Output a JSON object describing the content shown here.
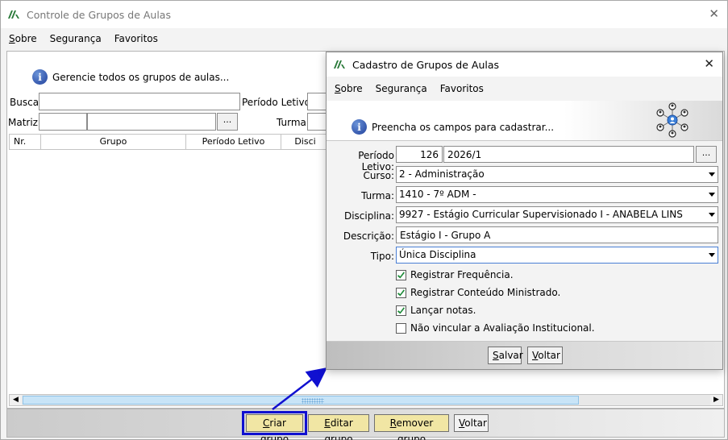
{
  "main": {
    "title": "Controle de Grupos de Aulas",
    "menu": [
      {
        "prefix": "S",
        "rest": "obre"
      },
      {
        "prefix": "",
        "rest": "Segurança"
      },
      {
        "prefix": "",
        "rest": "Favoritos"
      }
    ],
    "info_text": "Gerencie todos os grupos de aulas...",
    "busca_label": "Busca:",
    "periodo_label": "Período Letivo:",
    "matriz_label": "Matriz:",
    "turma_label": "Turma:",
    "dots": "...",
    "columns": [
      "Nr.",
      "Grupo",
      "Período Letivo",
      "Disci"
    ],
    "buttons": {
      "criar": {
        "u": "C",
        "rest": "riar grupo"
      },
      "editar": {
        "u": "E",
        "rest": "ditar grupo"
      },
      "remover": {
        "u": "R",
        "rest": "emover grupo"
      },
      "voltar": {
        "u": "V",
        "rest": "oltar"
      }
    }
  },
  "dialog": {
    "title": "Cadastro de Grupos de Aulas",
    "menu": [
      {
        "prefix": "S",
        "rest": "obre"
      },
      {
        "prefix": "",
        "rest": "Segurança"
      },
      {
        "prefix": "",
        "rest": "Favoritos"
      }
    ],
    "info_text": "Preencha os campos para cadastrar...",
    "fields": {
      "periodo": {
        "label": "Período Letivo:",
        "code": "126",
        "value": "2026/1"
      },
      "curso": {
        "label": "Curso:",
        "value": "2 - Administração"
      },
      "turma": {
        "label": "Turma:",
        "value": "1410 - 7º ADM -"
      },
      "disciplina": {
        "label": "Disciplina:",
        "value": "9927 - Estágio Curricular Supervisionado I - ANABELA LINS"
      },
      "descricao": {
        "label": "Descrição:",
        "value": "Estágio I - Grupo A"
      },
      "tipo": {
        "label": "Tipo:",
        "value": "Única Disciplina"
      }
    },
    "dots": "...",
    "checks": [
      {
        "label": "Registrar Frequência.",
        "checked": true
      },
      {
        "label": "Registrar Conteúdo Ministrado.",
        "checked": true
      },
      {
        "label": "Lançar notas.",
        "checked": true
      },
      {
        "label": "Não vincular a Avaliação Institucional.",
        "checked": false
      }
    ],
    "buttons": {
      "salvar": {
        "u": "S",
        "rest": "alvar"
      },
      "voltar": {
        "u": "V",
        "rest": "oltar"
      }
    }
  },
  "colors": {
    "accent": "#1010d0",
    "yellow_button": "#f1e6a4",
    "check": "#1f8b3a"
  }
}
